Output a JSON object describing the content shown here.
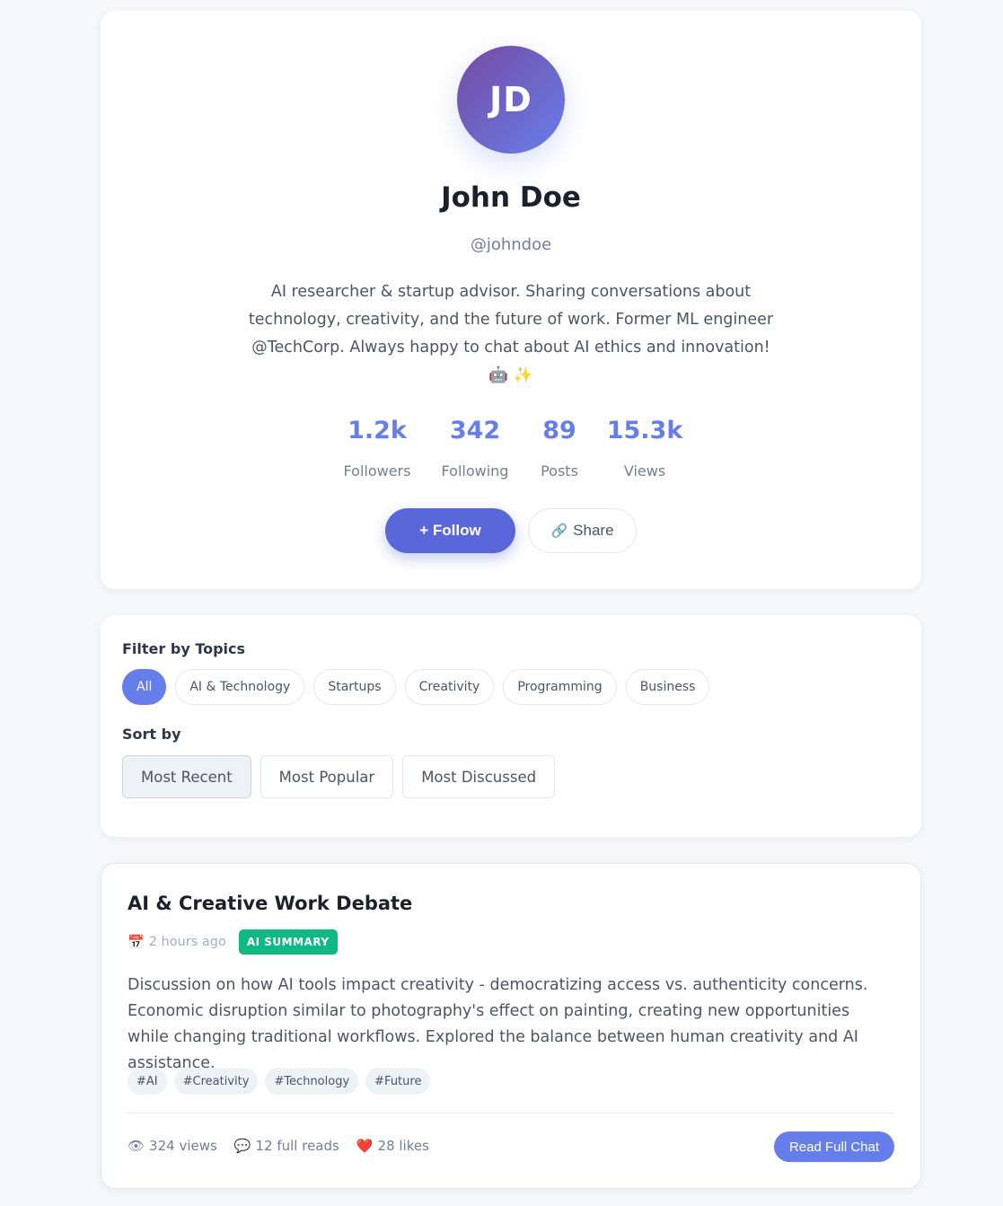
{
  "profile": {
    "initials": "JD",
    "name": "John Doe",
    "handle": "@johndoe",
    "bio": "AI researcher & startup advisor. Sharing conversations about technology, creativity, and the future of work. Former ML engineer @TechCorp. Always happy to chat about AI ethics and innovation! 🤖 ✨",
    "stats": [
      {
        "value": "1.2k",
        "label": "Followers"
      },
      {
        "value": "342",
        "label": "Following"
      },
      {
        "value": "89",
        "label": "Posts"
      },
      {
        "value": "15.3k",
        "label": "Views"
      }
    ],
    "follow_label": "+ Follow",
    "share_label": "Share",
    "share_icon": "🔗"
  },
  "filters": {
    "topics_label": "Filter by Topics",
    "topics": [
      "All",
      "AI & Technology",
      "Startups",
      "Creativity",
      "Programming",
      "Business"
    ],
    "active_topic": "All",
    "sort_label": "Sort by",
    "sorts": [
      "Most Recent",
      "Most Popular",
      "Most Discussed"
    ],
    "active_sort": "Most Recent"
  },
  "post": {
    "title": "AI & Creative Work Debate",
    "date_icon": "📅",
    "date": "2 hours ago",
    "badge": "AI SUMMARY",
    "body": "Discussion on how AI tools impact creativity - democratizing access vs. authenticity concerns. Economic disruption similar to photography's effect on painting, creating new opportunities while changing traditional workflows. Explored the balance between human creativity and AI assistance.",
    "tags": [
      "#AI",
      "#Creativity",
      "#Technology",
      "#Future"
    ],
    "views_icon": "👁",
    "views": "324 views",
    "reads_icon": "💬",
    "reads": "12 full reads",
    "likes_icon": "❤️",
    "likes": "28 likes",
    "read_button": "Read Full Chat"
  },
  "colors": {
    "accent": "#667eea",
    "follow_button": "#5a67d8",
    "badge": "#10b981",
    "background": "#f7f8fb"
  }
}
